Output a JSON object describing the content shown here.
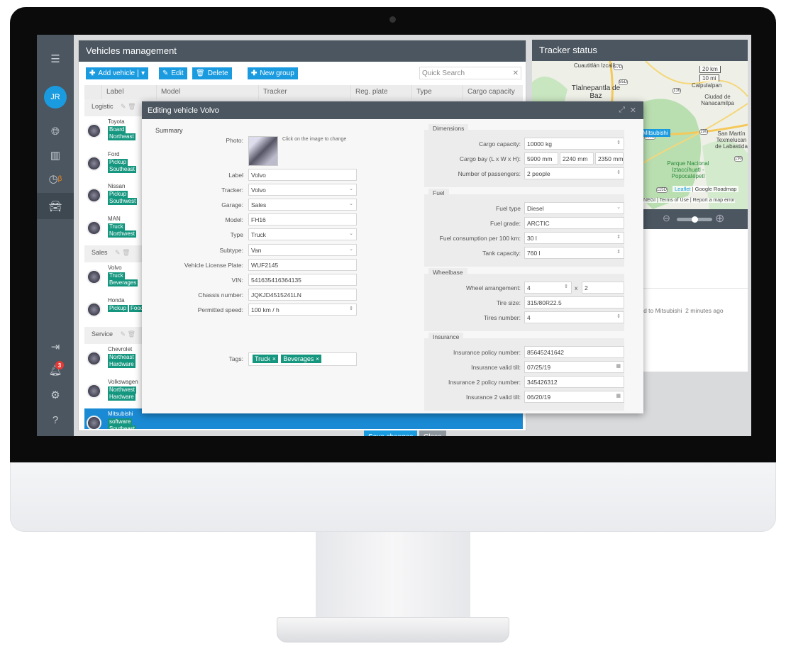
{
  "sidebar": {
    "avatar": "JR",
    "beta": "β",
    "notifications": "3"
  },
  "vehicles_panel": {
    "title": "Vehicles management",
    "toolbar": {
      "add": "Add vehicle",
      "edit": "Edit",
      "delete": "Delete",
      "new_group": "New group"
    },
    "search_placeholder": "Quick Search",
    "columns": [
      "Label",
      "Model",
      "Tracker",
      "Reg. plate",
      "Type",
      "Cargo capacity"
    ],
    "groups": [
      {
        "name": "Logistic",
        "vehicles": [
          {
            "name": "Toyota",
            "tags": [
              "Board",
              "Northeast"
            ]
          },
          {
            "name": "Ford",
            "tags": [
              "Pickup",
              "Southeast"
            ]
          },
          {
            "name": "Nissan",
            "tags": [
              "Pickup",
              "Southwest"
            ]
          },
          {
            "name": "MAN",
            "tags": [
              "Truck",
              "Northwest"
            ]
          }
        ]
      },
      {
        "name": "Sales",
        "vehicles": [
          {
            "name": "Volvo",
            "tags": [
              "Truck",
              "Beverages"
            ]
          },
          {
            "name": "Honda",
            "tags": [
              "Pickup",
              "Food"
            ]
          }
        ]
      },
      {
        "name": "Service",
        "vehicles": [
          {
            "name": "Chevrolet",
            "tags": [
              "Northeast",
              "Hardware"
            ]
          },
          {
            "name": "Volkswagen",
            "tags": [
              "Northwest",
              "Hardware"
            ]
          },
          {
            "name": "Mitsubishi",
            "tags": [
              "software",
              "Southeast"
            ],
            "selected": true
          }
        ]
      }
    ]
  },
  "tracker_panel": {
    "title": "Tracker status",
    "map_labels": [
      "Cuautitlán Izcalli",
      "Tlalnepantla de Baz",
      "Calpulalpan",
      "Ciudad de Nanacamilpa",
      "San Martín Texmelucan de Labastida",
      "Parque Nacional Iztaccíhuatl - Popocatépetl"
    ],
    "road_shields": [
      "57D",
      "85D",
      "136",
      "190",
      "190",
      "150D",
      "115D"
    ],
    "scale": [
      "20 km",
      "10 mi"
    ],
    "marker_label": "Mitsubishi",
    "attribution": {
      "leaflet": "Leaflet",
      "provider": "Google Roadmap",
      "inegi": "INEGI",
      "terms": "Terms of Use",
      "report": "Report a map error"
    },
    "zoom_level": 0.5,
    "event": {
      "text": "...d to Mitsubishi",
      "time": "2 minutes ago"
    }
  },
  "modal": {
    "title": "Editing vehicle Volvo",
    "summary": "Summary",
    "photo_label": "Photo:",
    "photo_hint": "Click on the image to change",
    "fields": [
      {
        "label": "Label",
        "value": "Volvo",
        "kind": "text"
      },
      {
        "label": "Tracker:",
        "value": "Volvo",
        "kind": "select"
      },
      {
        "label": "Garage:",
        "value": "Sales",
        "kind": "select"
      },
      {
        "label": "Model:",
        "value": "FH16",
        "kind": "text"
      },
      {
        "label": "Type",
        "value": "Truck",
        "kind": "select"
      },
      {
        "label": "Subtype:",
        "value": "Van",
        "kind": "select"
      },
      {
        "label": "Vehicle License Plate:",
        "value": "WUF2145",
        "kind": "text"
      },
      {
        "label": "VIN:",
        "value": "541635416364135",
        "kind": "text"
      },
      {
        "label": "Chassis number:",
        "value": "JQKJD4515241LN",
        "kind": "text"
      },
      {
        "label": "Permitted speed:",
        "value": "100  km / h",
        "kind": "spin"
      }
    ],
    "tags_label": "Tags:",
    "tags": [
      "Truck",
      "Beverages"
    ],
    "sections": [
      {
        "title": "Dimensions",
        "rows": [
          {
            "label": "Cargo capacity:",
            "values": [
              "10000  kg"
            ],
            "kind": "spin"
          },
          {
            "label": "Cargo bay (L x W x H):",
            "values": [
              "5900  mm",
              "2240  mm",
              "2350  mm"
            ],
            "kind": "triple"
          },
          {
            "label": "Number of passengers:",
            "values": [
              "2  people"
            ],
            "kind": "spin"
          }
        ]
      },
      {
        "title": "Fuel",
        "rows": [
          {
            "label": "Fuel type",
            "values": [
              "Diesel"
            ],
            "kind": "select"
          },
          {
            "label": "Fuel grade:",
            "values": [
              "ARCTIC"
            ],
            "kind": "text"
          },
          {
            "label": "Fuel consumption per 100 km:",
            "values": [
              "30  l"
            ],
            "kind": "spin"
          },
          {
            "label": "Tank capacity:",
            "values": [
              "760  l"
            ],
            "kind": "spin"
          }
        ]
      },
      {
        "title": "Wheelbase",
        "rows": [
          {
            "label": "Wheel arrangement:",
            "values": [
              "4",
              "2"
            ],
            "kind": "pair",
            "sep": "x"
          },
          {
            "label": "Tire size:",
            "values": [
              "315/80R22.5"
            ],
            "kind": "text"
          },
          {
            "label": "Tires number:",
            "values": [
              "4"
            ],
            "kind": "spin"
          }
        ]
      },
      {
        "title": "Insurance",
        "rows": [
          {
            "label": "Insurance policy number:",
            "values": [
              "85645241642"
            ],
            "kind": "text"
          },
          {
            "label": "Insurance valid till:",
            "values": [
              "07/25/19"
            ],
            "kind": "date"
          },
          {
            "label": "Insurance 2 policy number:",
            "values": [
              "345426312"
            ],
            "kind": "text"
          },
          {
            "label": "Insurance 2 valid till:",
            "values": [
              "06/20/19"
            ],
            "kind": "date"
          }
        ]
      }
    ],
    "save": "Save changes",
    "close": "Close"
  },
  "colors": {
    "accent": "#1a9be0",
    "tag": "#15967f",
    "header": "#4b5660",
    "selected": "#1a8ad4"
  }
}
